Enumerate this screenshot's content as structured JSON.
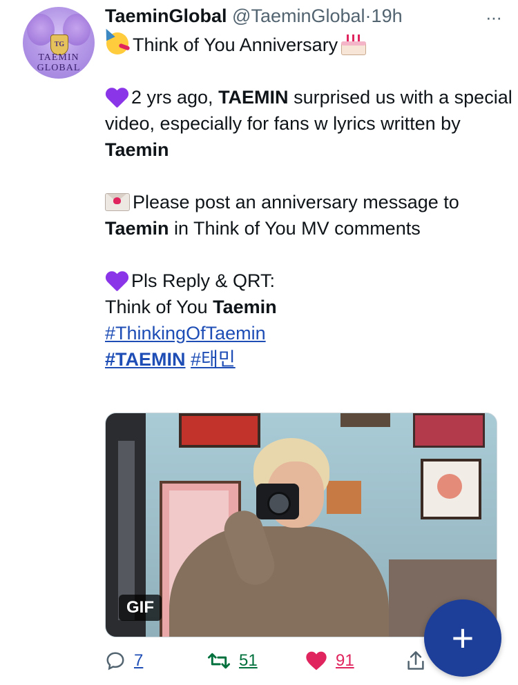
{
  "tweet": {
    "avatar_text": "TAEMIN GLOBAL",
    "avatar_crest": "TG",
    "author_name": "TaeminGlobal",
    "handle": "@TaeminGlobal",
    "separator": "·",
    "time": "19h",
    "more": "···",
    "line1": "Think of You Anniversary",
    "p1_a": "2 yrs ago, ",
    "p1_b": "TAEMIN",
    "p1_c": " surprised us with a special video, especially for fans w lyrics written by ",
    "p1_d": "Taemin",
    "p2_a": "Please post an anniversary message to ",
    "p2_b": "Taemin",
    "p2_c": " in Think of You MV comments",
    "p3_a": "Pls Reply & QRT:",
    "p3_b": "Think of You ",
    "p3_c": "Taemin",
    "hashtag1": "#ThinkingOfTaemin",
    "hashtag2": "#TAEMIN",
    "hashtag3": "#태민",
    "media_badge": "GIF"
  },
  "actions": {
    "replies": "7",
    "retweets": "51",
    "likes": "91"
  },
  "colors": {
    "link": "#1d4db5",
    "retweet": "#00703c",
    "like": "#e0245e",
    "fab": "#1d3f9a"
  },
  "fab_label": "+"
}
